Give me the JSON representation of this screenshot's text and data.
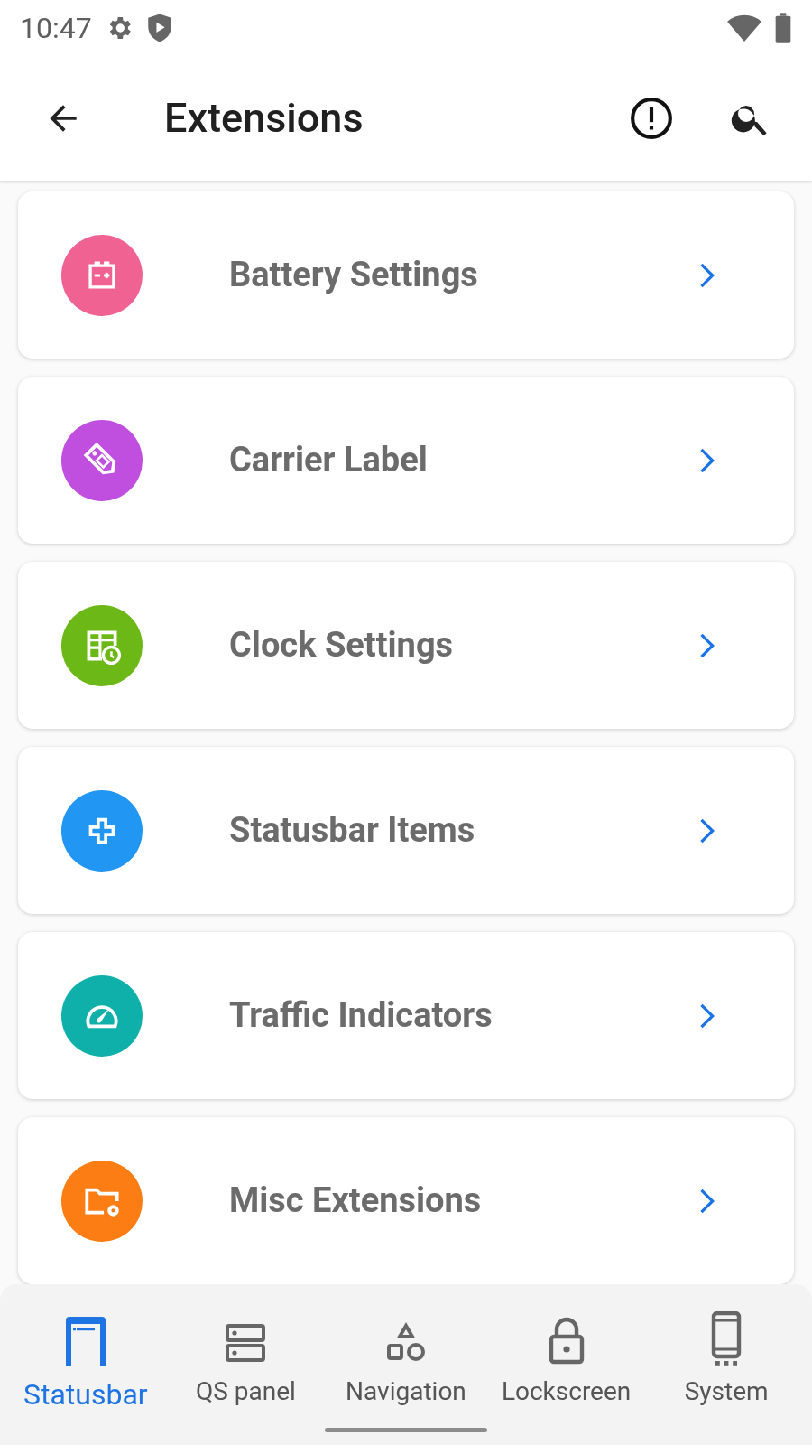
{
  "status_bar": {
    "time": "10:47"
  },
  "app_bar": {
    "title": "Extensions"
  },
  "items": [
    {
      "label": "Battery Settings",
      "kind": "battery",
      "color": "#f06292"
    },
    {
      "label": "Carrier Label",
      "kind": "tag",
      "color": "#c04fe0"
    },
    {
      "label": "Clock Settings",
      "kind": "clock",
      "color": "#6cb816"
    },
    {
      "label": "Statusbar Items",
      "kind": "plus",
      "color": "#2196f3"
    },
    {
      "label": "Traffic Indicators",
      "kind": "gauge",
      "color": "#10b0aa"
    },
    {
      "label": "Misc Extensions",
      "kind": "folder",
      "color": "#fb7d14"
    }
  ],
  "bottom_nav": [
    {
      "label": "Statusbar",
      "kind": "statusbar",
      "selected": true
    },
    {
      "label": "QS panel",
      "kind": "qs",
      "selected": false
    },
    {
      "label": "Navigation",
      "kind": "shapes",
      "selected": false
    },
    {
      "label": "Lockscreen",
      "kind": "lock",
      "selected": false
    },
    {
      "label": "System",
      "kind": "phone",
      "selected": false
    }
  ]
}
